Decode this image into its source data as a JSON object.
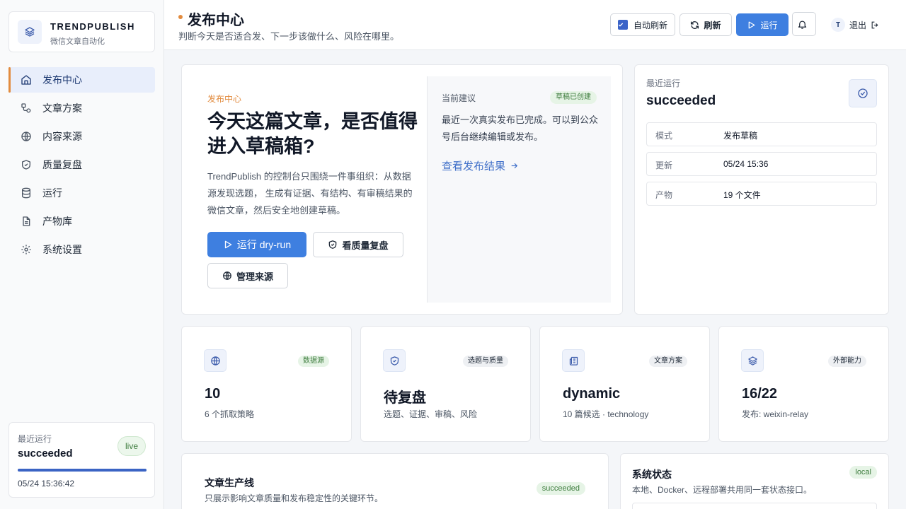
{
  "brand": {
    "name": "TRENDPUBLISH",
    "subtitle": "微信文章自动化",
    "icon": "layers-icon"
  },
  "sidebar": {
    "items": [
      {
        "label": "发布中心",
        "icon": "home-icon",
        "active": true
      },
      {
        "label": "文章方案",
        "icon": "flow-icon"
      },
      {
        "label": "内容来源",
        "icon": "globe-icon"
      },
      {
        "label": "质量复盘",
        "icon": "shield-icon"
      },
      {
        "label": "运行",
        "icon": "database-icon"
      },
      {
        "label": "产物库",
        "icon": "file-icon"
      },
      {
        "label": "系统设置",
        "icon": "gear-icon"
      }
    ],
    "status": {
      "label": "最近运行",
      "value": "succeeded",
      "badge": "live",
      "progress": 1.0,
      "time": "05/24 15:36:42"
    }
  },
  "header": {
    "title": "发布中心",
    "subtitle": "判断今天是否适合发、下一步该做什么、风险在哪里。",
    "auto_refresh_label": "自动刷新",
    "auto_refresh_checked": true,
    "refresh_label": "刷新",
    "run_label": "运行",
    "user_initial": "T",
    "logout_label": "退出"
  },
  "hero": {
    "kicker": "发布中心",
    "title": "今天这篇文章，是否值得进入草稿箱?",
    "description": "TrendPublish 的控制台只围绕一件事组织：从数据源发现选题， 生成有证据、有结构、有审稿结果的微信文章，然后安全地创建草稿。",
    "primary_button": "运行 dry-run",
    "quality_button": "看质量复盘",
    "sources_button": "管理来源",
    "suggestion": {
      "label": "当前建议",
      "badge": "草稿已创建",
      "text": "最近一次真实发布已完成。可以到公众号后台继续编辑或发布。",
      "link": "查看发布结果"
    }
  },
  "recent_run": {
    "label": "最近运行",
    "status": "succeeded",
    "rows": [
      {
        "key": "模式",
        "value": "发布草稿"
      },
      {
        "key": "更新",
        "value": "05/24 15:36"
      },
      {
        "key": "产物",
        "value": "19 个文件"
      }
    ]
  },
  "stats": [
    {
      "icon": "globe-icon",
      "tag": "数据源",
      "tag_color": "green",
      "value": "10",
      "sub": "6 个抓取策略"
    },
    {
      "icon": "shield-check-icon",
      "tag": "选题与质量",
      "tag_color": "gray",
      "value": "待复盘",
      "sub": "选题、证据、审稿、风险"
    },
    {
      "icon": "newspaper-icon",
      "tag": "文章方案",
      "tag_color": "gray",
      "value": "dynamic",
      "sub": "10 篇候选 · technology"
    },
    {
      "icon": "layers-icon",
      "tag": "外部能力",
      "tag_color": "gray",
      "value": "16/22",
      "sub": "发布: weixin-relay"
    }
  ],
  "pipeline": {
    "title": "文章生产线",
    "subtitle": "只展示影响文章质量和发布稳定性的关键环节。",
    "badge": "succeeded"
  },
  "system": {
    "title": "系统状态",
    "subtitle": "本地、Docker、远程部署共用同一套状态接口。",
    "badge": "local"
  },
  "colors": {
    "accent": "#3e7fe0",
    "active_marker": "#e28b3e",
    "success_bg": "#e6f4e6"
  }
}
